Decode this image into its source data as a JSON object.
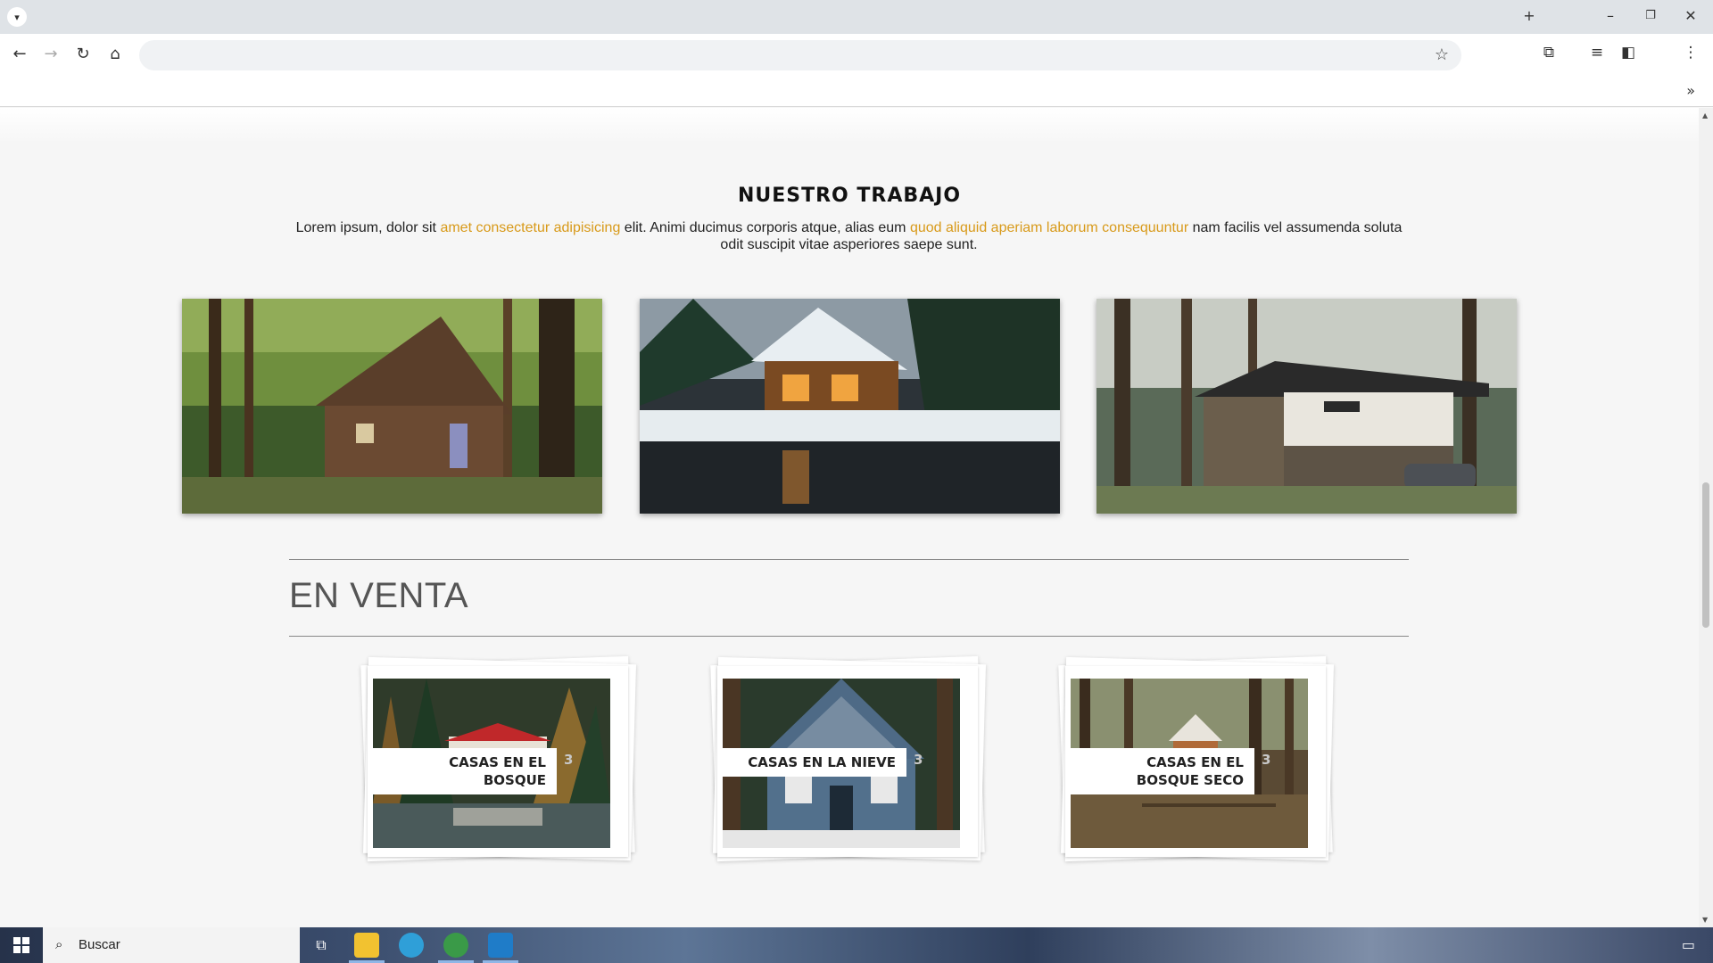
{
  "browser": {
    "url": "",
    "window_controls": [
      "+",
      "–",
      "❐",
      "✕"
    ]
  },
  "page": {
    "work_title": "NUESTRO TRABAJO",
    "intro": {
      "p1": "Lorem ipsum, dolor sit ",
      "link1": "amet consectetur adipisicing",
      "p2": " elit. Animi ducimus corporis atque, alias eum ",
      "link2": "quod aliquid aperiam laborum consequuntur",
      "p3": " nam facilis vel assumenda soluta odit suscipit vitae asperiores saepe sunt."
    },
    "sale_title": "EN VENTA",
    "cards": [
      {
        "label": "CASAS EN EL BOSQUE",
        "count": "3"
      },
      {
        "label": "CASAS EN LA NIEVE",
        "count": "3"
      },
      {
        "label": "CASAS EN EL BOSQUE SECO",
        "count": "3"
      }
    ]
  },
  "taskbar": {
    "search_placeholder": "Buscar"
  },
  "colors": {
    "accent": "#d89a1a"
  }
}
